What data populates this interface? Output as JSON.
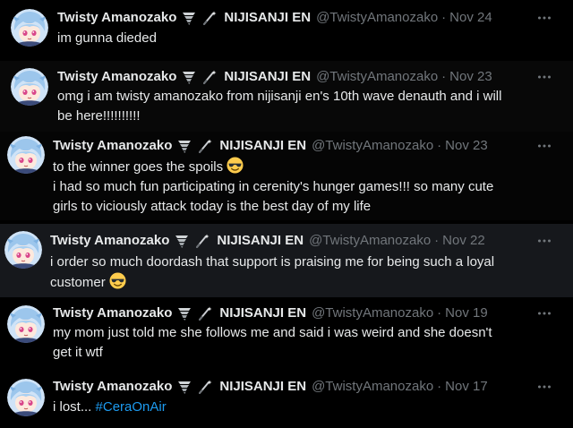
{
  "colors": {
    "background": "#000000",
    "text_primary": "#e7e9ea",
    "text_secondary": "#71767b",
    "link": "#1d9bf0",
    "hover_row": "#16181c"
  },
  "tweets": [
    {
      "author": {
        "name": "Twisty Amanozako",
        "org": "NIJISANJI EN",
        "handle": "@TwistyAmanozako"
      },
      "sep": "·",
      "date": "Nov 24",
      "lines": [
        "im gunna dieded"
      ]
    },
    {
      "author": {
        "name": "Twisty Amanozako",
        "org": "NIJISANJI EN",
        "handle": "@TwistyAmanozako"
      },
      "sep": "·",
      "date": "Nov 23",
      "lines": [
        "omg i am twisty amanozako from nijisanji en's 10th wave denauth and i will",
        "be here!!!!!!!!!!"
      ]
    },
    {
      "author": {
        "name": "Twisty Amanozako",
        "org": "NIJISANJI EN",
        "handle": "@TwistyAmanozako"
      },
      "sep": "·",
      "date": "Nov 23",
      "lines": [
        "to the winner goes the spoils",
        "i had so much fun participating in cerenity's hunger games!!! so many cute",
        "girls to viciously attack today is the best day of my life"
      ],
      "emoji": "sunglasses-emoji"
    },
    {
      "author": {
        "name": "Twisty Amanozako",
        "org": "NIJISANJI EN",
        "handle": "@TwistyAmanozako"
      },
      "sep": "·",
      "date": "Nov 22",
      "lines": [
        "i order so much doordash that support is praising me for being such a loyal",
        "customer"
      ],
      "emoji": "sunglasses-emoji"
    },
    {
      "author": {
        "name": "Twisty Amanozako",
        "org": "NIJISANJI EN",
        "handle": "@TwistyAmanozako"
      },
      "sep": "·",
      "date": "Nov 19",
      "lines": [
        "my mom just told me she follows me and said i was weird and she doesn't",
        "get it wtf"
      ]
    },
    {
      "author": {
        "name": "Twisty Amanozako",
        "org": "NIJISANJI EN",
        "handle": "@TwistyAmanozako"
      },
      "sep": "·",
      "date": "Nov 17",
      "lines": [
        "i lost..."
      ],
      "hashtag": "#CeraOnAir"
    }
  ],
  "icons": {
    "badge_1": "tornado-icon",
    "badge_2": "wand-icon",
    "more": "more-options-icon"
  }
}
